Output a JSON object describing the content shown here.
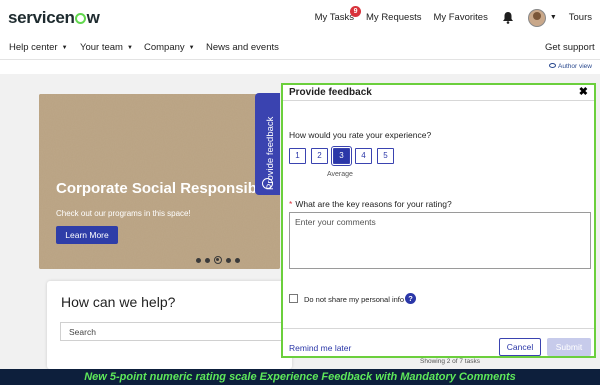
{
  "brand": {
    "logo_text_a": "servicen",
    "logo_text_b": "w"
  },
  "top_nav": {
    "my_tasks": "My Tasks",
    "tasks_badge": "9",
    "my_requests": "My Requests",
    "my_favorites": "My Favorites",
    "tours": "Tours"
  },
  "main_nav": {
    "items": [
      "Help center",
      "Your team",
      "Company",
      "News and events"
    ],
    "get_support": "Get support"
  },
  "author_view": "Author view",
  "hero": {
    "title": "Corporate Social Responsibi",
    "subtitle": "Check out our programs in this space!",
    "button": "Learn More",
    "slide_count": 5,
    "active_slide": 3
  },
  "feedback_tab": "Provide feedback",
  "help": {
    "title": "How can we help?",
    "search_placeholder": "Search"
  },
  "showing_text": "Showing 2 of 7 tasks",
  "modal": {
    "title": "Provide feedback",
    "close": "✖",
    "question": "How would you rate your experience?",
    "ratings": [
      "1",
      "2",
      "3",
      "4",
      "5"
    ],
    "selected_rating": 3,
    "selected_caption": "Average",
    "reasons_label": "What are the key reasons for your rating?",
    "required_marker": "*",
    "comments_placeholder": "Enter your comments",
    "privacy_label": "Do not share my personal info",
    "help_icon": "?",
    "remind_later": "Remind me later",
    "cancel": "Cancel",
    "submit": "Submit"
  },
  "caption": "New 5-point numeric rating scale Experience Feedback with Mandatory Comments",
  "colors": {
    "accent": "#2b37a8",
    "feedback_tab": "#3a43b0",
    "highlight_border": "#6bcf3c",
    "caption_bg": "#0d1f3c",
    "caption_text": "#5ee85a"
  }
}
